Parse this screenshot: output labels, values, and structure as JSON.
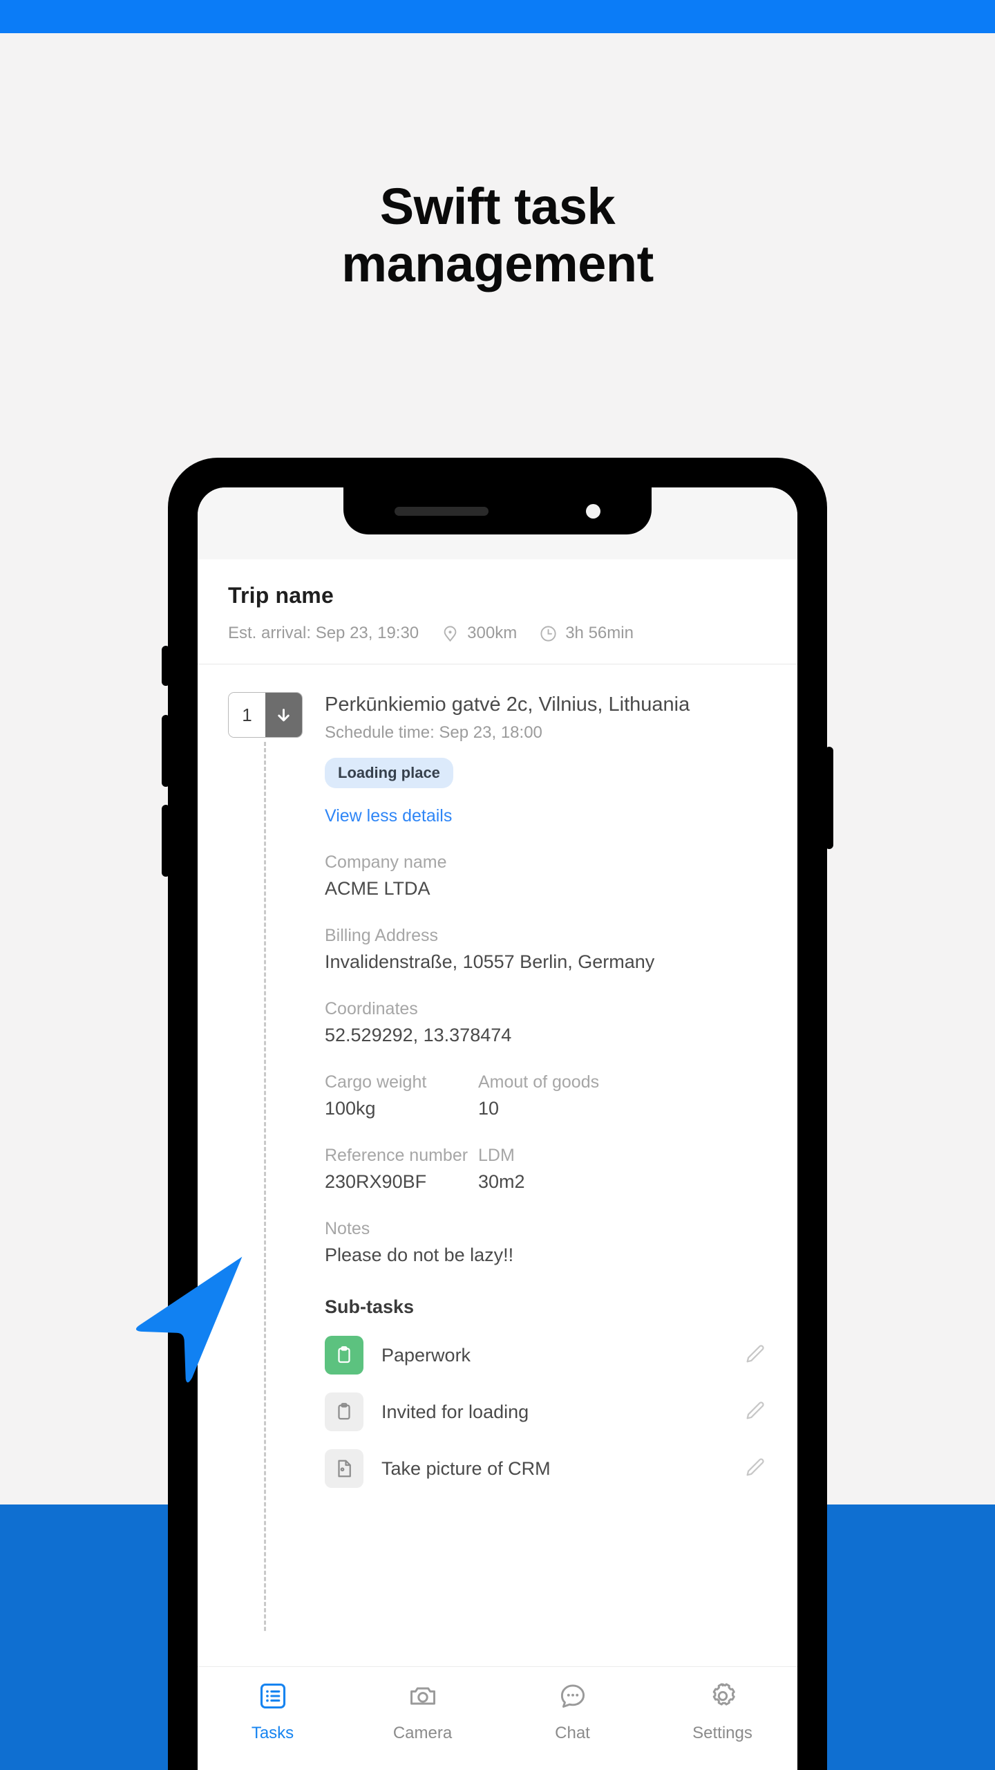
{
  "theme": {
    "brand_blue": "#0b7cf7",
    "band_bottom_blue": "#0f6fd1",
    "page_bg": "#f4f3f3",
    "link_blue": "#2f86f6",
    "badge_bg": "#dceafb",
    "subtask_done_green": "#5cc27f",
    "cursor_blue": "#1181f2"
  },
  "promo": {
    "headline_line1": "Swift task",
    "headline_line2": "management"
  },
  "app": {
    "header": {
      "trip_title": "Trip name",
      "est_arrival": "Est. arrival: Sep 23, 19:30",
      "distance": "300km",
      "duration": "3h 56min",
      "distance_icon": "map-pin-icon",
      "duration_icon": "clock-icon"
    },
    "task": {
      "step_number": "1",
      "step_direction_icon": "arrow-down-icon",
      "address": "Perkūnkiemio gatvė 2c, Vilnius, Lithuania",
      "schedule_time": "Schedule time: Sep 23, 18:00",
      "place_badge": "Loading place",
      "details_toggle": "View less details",
      "fields": [
        {
          "label": "Company name",
          "value": "ACME LTDA"
        },
        {
          "label": "Billing Address",
          "value": "Invalidenstraße, 10557 Berlin, Germany"
        },
        {
          "label": "Coordinates",
          "value": "52.529292, 13.378474"
        }
      ],
      "field_pairs": [
        {
          "left": {
            "label": "Cargo weight",
            "value": "100kg"
          },
          "right": {
            "label": "Amout of goods",
            "value": "10"
          }
        },
        {
          "left": {
            "label": "Reference number",
            "value": "230RX90BF"
          },
          "right": {
            "label": "LDM",
            "value": "30m2"
          }
        }
      ],
      "notes": {
        "label": "Notes",
        "value": "Please do not be lazy!!"
      },
      "subtasks_title": "Sub-tasks",
      "subtasks": [
        {
          "label": "Paperwork",
          "status": "done",
          "icon": "clipboard-icon",
          "edit_icon": "pencil-icon"
        },
        {
          "label": "Invited for loading",
          "status": "todo",
          "icon": "clipboard-icon",
          "edit_icon": "pencil-icon"
        },
        {
          "label": "Take picture of CRM",
          "status": "todo",
          "icon": "document-image-icon",
          "edit_icon": "pencil-icon"
        }
      ]
    },
    "bottom_nav": [
      {
        "label": "Tasks",
        "icon": "list-icon",
        "active": true
      },
      {
        "label": "Camera",
        "icon": "camera-icon",
        "active": false
      },
      {
        "label": "Chat",
        "icon": "chat-bubble-icon",
        "active": false
      },
      {
        "label": "Settings",
        "icon": "gear-icon",
        "active": false
      }
    ]
  },
  "cursor": {
    "icon": "arrow-cursor-icon"
  }
}
